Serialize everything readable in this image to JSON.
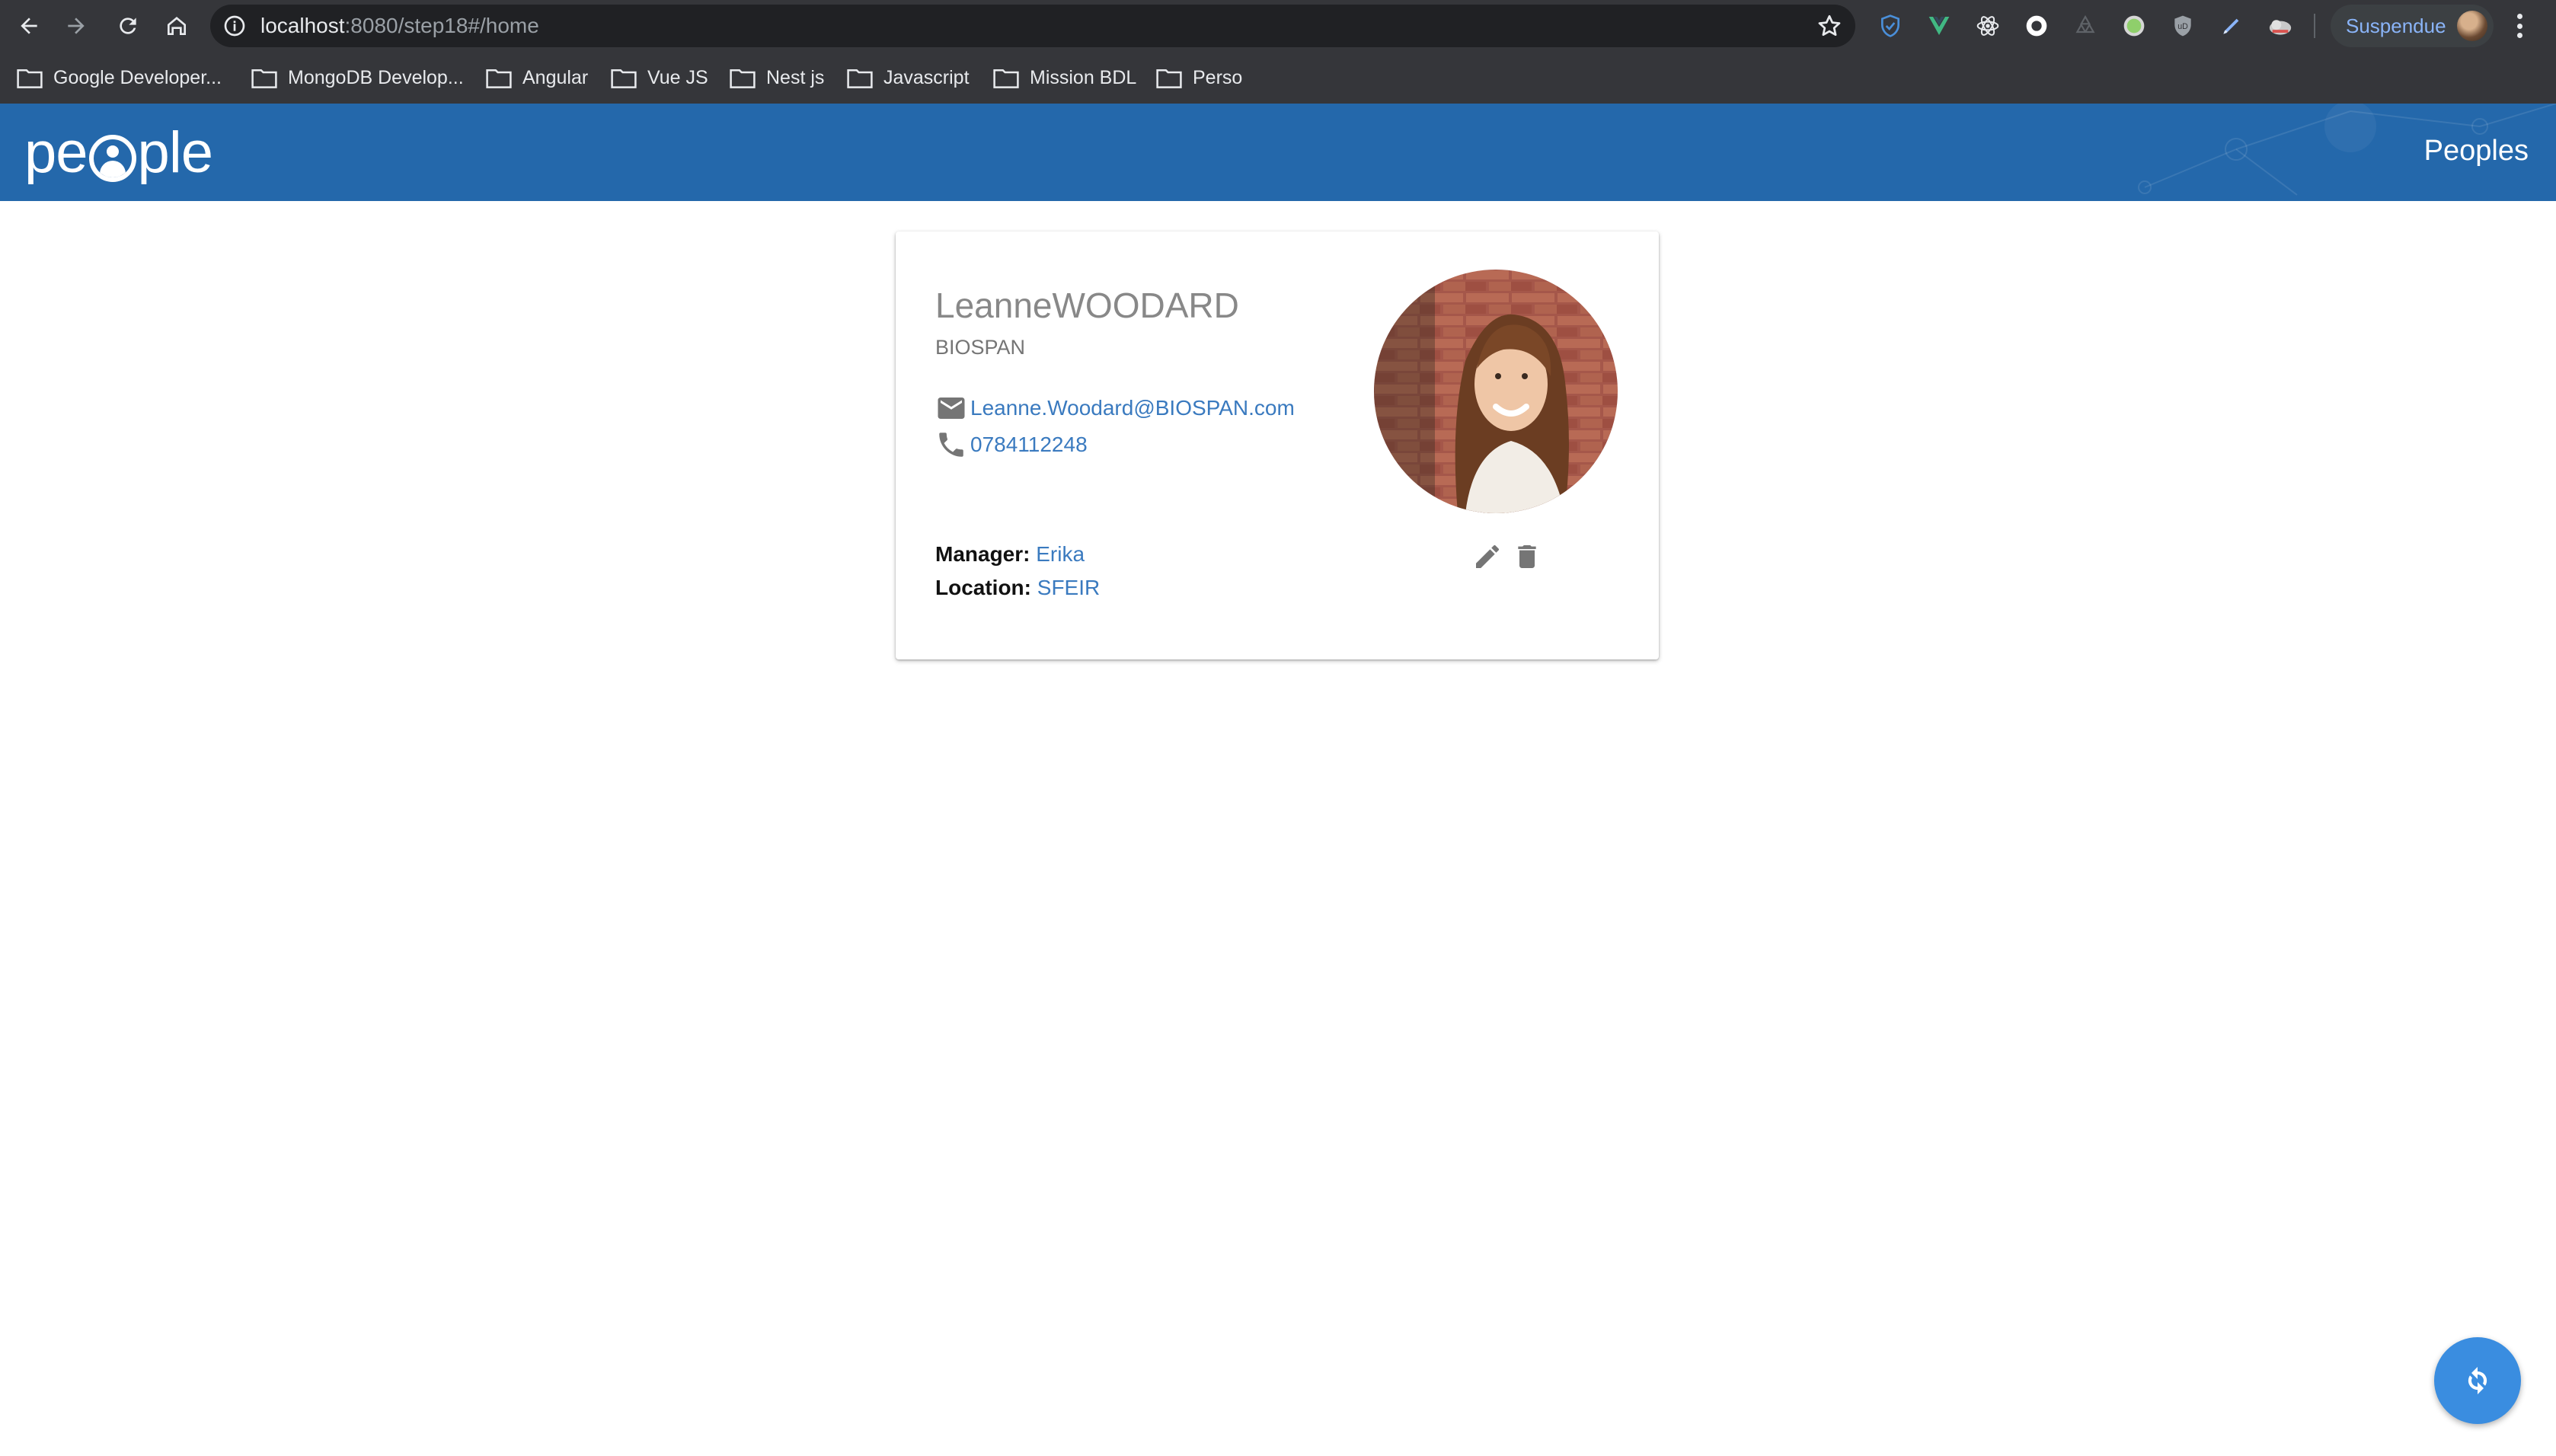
{
  "browser": {
    "url_host": "localhost",
    "url_rest": ":8080/step18#/home",
    "bookmarks": [
      {
        "label": "Google Developer..."
      },
      {
        "label": "MongoDB Develop..."
      },
      {
        "label": "Angular"
      },
      {
        "label": "Vue JS"
      },
      {
        "label": "Nest js"
      },
      {
        "label": "Javascript"
      },
      {
        "label": "Mission BDL"
      },
      {
        "label": "Perso"
      }
    ],
    "profile_label": "Suspendue",
    "extension_icons": [
      "shield-icon",
      "vue-devtools-icon",
      "react-devtools-icon",
      "circle-extension-icon",
      "recycle-icon",
      "green-dot-icon",
      "ublock-icon",
      "pen-icon",
      "cloud-icon"
    ]
  },
  "header": {
    "logo_prefix": "pe",
    "logo_suffix": "ple",
    "nav_link": "Peoples"
  },
  "person": {
    "name": "LeanneWOODARD",
    "company": "BIOSPAN",
    "email": "Leanne.Woodard@BIOSPAN.com",
    "phone": "0784112248",
    "manager_label": "Manager:",
    "manager": "Erika",
    "location_label": "Location:",
    "location": "SFEIR"
  },
  "colors": {
    "header_bg": "#2468ab",
    "link": "#3a7abf",
    "fab": "#3a8de0",
    "chrome_bg": "#35363a"
  }
}
